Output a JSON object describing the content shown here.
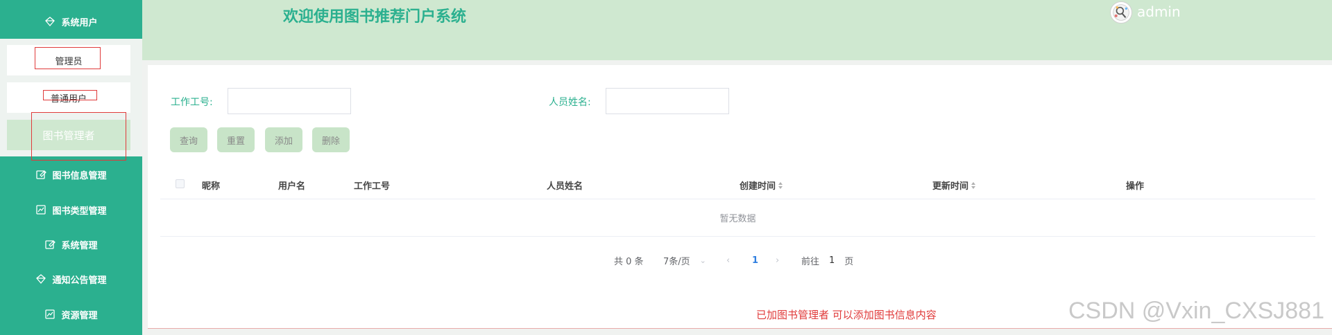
{
  "sidebar": {
    "system_users": {
      "label": "系统用户",
      "icon": "diamond-icon"
    },
    "sub_items": [
      {
        "label": "管理员"
      },
      {
        "label": "普通用户"
      },
      {
        "label": "图书管理者"
      }
    ],
    "items": [
      {
        "label": "图书信息管理",
        "icon": "edit-icon"
      },
      {
        "label": "图书类型管理",
        "icon": "chart-icon"
      },
      {
        "label": "系统管理",
        "icon": "edit-icon"
      },
      {
        "label": "通知公告管理",
        "icon": "diamond-icon"
      },
      {
        "label": "资源管理",
        "icon": "chart-icon"
      }
    ]
  },
  "header": {
    "title": "欢迎使用图书推荐门户系统",
    "username": "admin"
  },
  "search": {
    "work_id_label": "工作工号:",
    "name_label": "人员姓名:",
    "work_id_value": "",
    "name_value": ""
  },
  "buttons": {
    "query": "查询",
    "reset": "重置",
    "add": "添加",
    "delete": "删除"
  },
  "table": {
    "columns": [
      "昵称",
      "用户名",
      "工作工号",
      "人员姓名",
      "创建时间",
      "更新时间",
      "操作"
    ],
    "empty_text": "暂无数据"
  },
  "pagination": {
    "total": "共 0 条",
    "page_size": "7条/页",
    "current_page": "1",
    "goto_prefix": "前往",
    "goto_value": "1",
    "goto_suffix": "页"
  },
  "annotation": {
    "note": "已加图书管理者 可以添加图书信息内容"
  },
  "watermark": "CSDN @Vxin_CXSJ881",
  "colors": {
    "sidebar": "#2bb08f",
    "header": "#cfe8d0",
    "accent": "#2bb08f",
    "annotation": "#e03a3a"
  }
}
